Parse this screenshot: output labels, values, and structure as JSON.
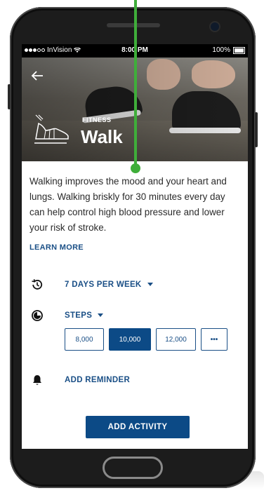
{
  "status_bar": {
    "carrier": "InVision",
    "time": "8:00 PM",
    "battery": "100%"
  },
  "hero": {
    "category": "FITNESS",
    "title": "Walk"
  },
  "description": "Walking improves the mood and your heart and lungs. Walking briskly for 30 minutes every day can help control high blood pressure and lower your risk of stroke.",
  "learn_more": "LEARN MORE",
  "frequency": {
    "label": "7 DAYS PER WEEK",
    "icon": "history-icon"
  },
  "goal": {
    "label": "STEPS",
    "icon": "progress-icon",
    "options": [
      "8,000",
      "10,000",
      "12,000",
      "•••"
    ],
    "selected": "10,000"
  },
  "reminder": {
    "label": "ADD REMINDER",
    "icon": "bell-icon"
  },
  "add_activity": "ADD ACTIVITY",
  "colors": {
    "primary": "#0c4a86",
    "annotation": "#3fae3a"
  }
}
